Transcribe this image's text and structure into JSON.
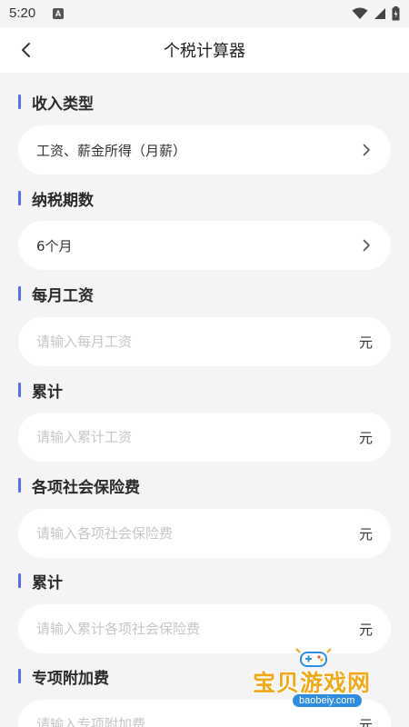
{
  "status": {
    "time": "5:20",
    "notif_icon": "a-icon"
  },
  "header": {
    "title": "个税计算器"
  },
  "sections": [
    {
      "label": "收入类型",
      "value": "工资、薪金所得（月薪）",
      "type": "select"
    },
    {
      "label": "纳税期数",
      "value": "6个月",
      "type": "select"
    },
    {
      "label": "每月工资",
      "placeholder": "请输入每月工资",
      "unit": "元",
      "type": "input"
    },
    {
      "label": "累计",
      "placeholder": "请输入累计工资",
      "unit": "元",
      "type": "input"
    },
    {
      "label": "各项社会保险费",
      "placeholder": "请输入各项社会保险费",
      "unit": "元",
      "type": "input"
    },
    {
      "label": "累计",
      "placeholder": "请输入累计各项社会保险费",
      "unit": "元",
      "type": "input"
    },
    {
      "label": "专项附加费",
      "placeholder": "请输入专项附加费",
      "unit": "元",
      "type": "input"
    }
  ],
  "watermark": {
    "title": "宝贝游戏网",
    "url": "baobeiy.com"
  },
  "colors": {
    "accent": "#5b6cf0",
    "background": "#f4f4f6",
    "field": "#ffffff",
    "watermark": "#f1a91a"
  }
}
